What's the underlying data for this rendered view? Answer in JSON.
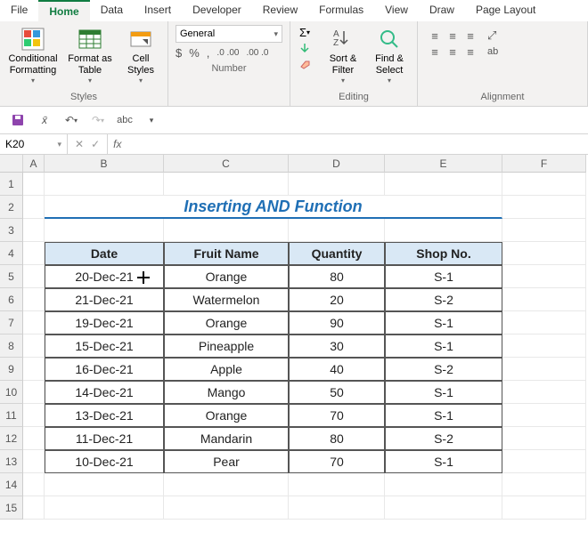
{
  "tabs": [
    "File",
    "Home",
    "Data",
    "Insert",
    "Developer",
    "Review",
    "Formulas",
    "View",
    "Draw",
    "Page Layout"
  ],
  "active_tab": "Home",
  "ribbon": {
    "styles": {
      "label": "Styles",
      "conditional": "Conditional Formatting",
      "format_table": "Format as Table",
      "cell_styles": "Cell Styles"
    },
    "number": {
      "label": "Number",
      "format": "General",
      "buttons": [
        "$",
        "%",
        ",",
        ".00→.0",
        ".0→.00"
      ]
    },
    "editing": {
      "label": "Editing",
      "sortfilter": "Sort & Filter",
      "findselect": "Find & Select"
    },
    "alignment": {
      "label": "Alignment",
      "abc": "ab"
    }
  },
  "namebox": "K20",
  "formula": "",
  "columns": [
    "A",
    "B",
    "C",
    "D",
    "E",
    "F"
  ],
  "title": "Inserting AND Function",
  "headers": {
    "date": "Date",
    "fruit": "Fruit Name",
    "qty": "Quantity",
    "shop": "Shop No."
  },
  "rows": [
    {
      "n": "1"
    },
    {
      "n": "2"
    },
    {
      "n": "3"
    },
    {
      "n": "4"
    },
    {
      "n": "5",
      "date": "20-Dec-21",
      "fruit": "Orange",
      "qty": "80",
      "shop": "S-1"
    },
    {
      "n": "6",
      "date": "21-Dec-21",
      "fruit": "Watermelon",
      "qty": "20",
      "shop": "S-2"
    },
    {
      "n": "7",
      "date": "19-Dec-21",
      "fruit": "Orange",
      "qty": "90",
      "shop": "S-1"
    },
    {
      "n": "8",
      "date": "15-Dec-21",
      "fruit": "Pineapple",
      "qty": "30",
      "shop": "S-1"
    },
    {
      "n": "9",
      "date": "16-Dec-21",
      "fruit": "Apple",
      "qty": "40",
      "shop": "S-2"
    },
    {
      "n": "10",
      "date": "14-Dec-21",
      "fruit": "Mango",
      "qty": "50",
      "shop": "S-1"
    },
    {
      "n": "11",
      "date": "13-Dec-21",
      "fruit": "Orange",
      "qty": "70",
      "shop": "S-1"
    },
    {
      "n": "12",
      "date": "11-Dec-21",
      "fruit": "Mandarin",
      "qty": "80",
      "shop": "S-2"
    },
    {
      "n": "13",
      "date": "10-Dec-21",
      "fruit": "Pear",
      "qty": "70",
      "shop": "S-1"
    },
    {
      "n": "14"
    },
    {
      "n": "15"
    }
  ]
}
